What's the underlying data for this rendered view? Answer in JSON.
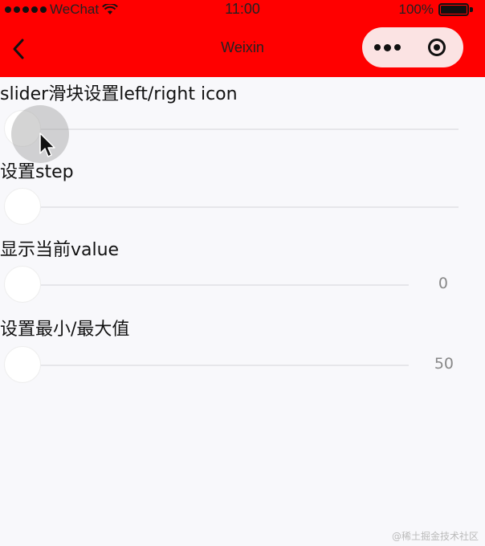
{
  "status_bar": {
    "carrier": "WeChat",
    "time": "11:00",
    "battery": "100%"
  },
  "nav": {
    "title": "Weixin"
  },
  "sections": [
    {
      "title": "slider滑块设置left/right icon",
      "value": "",
      "level": 0
    },
    {
      "title": "设置step",
      "value": "",
      "level": 0
    },
    {
      "title": "显示当前value",
      "value": "0",
      "level": 0
    },
    {
      "title": "设置最小/最大值",
      "value": "50",
      "level": 0
    }
  ],
  "watermark": "@稀土掘金技术社区",
  "colors": {
    "nav_background": "#ff0000",
    "capsule_background": "#fbe3e3",
    "page_background": "#f8f8fb",
    "track": "#e6e6ea",
    "value_text": "#888888"
  }
}
